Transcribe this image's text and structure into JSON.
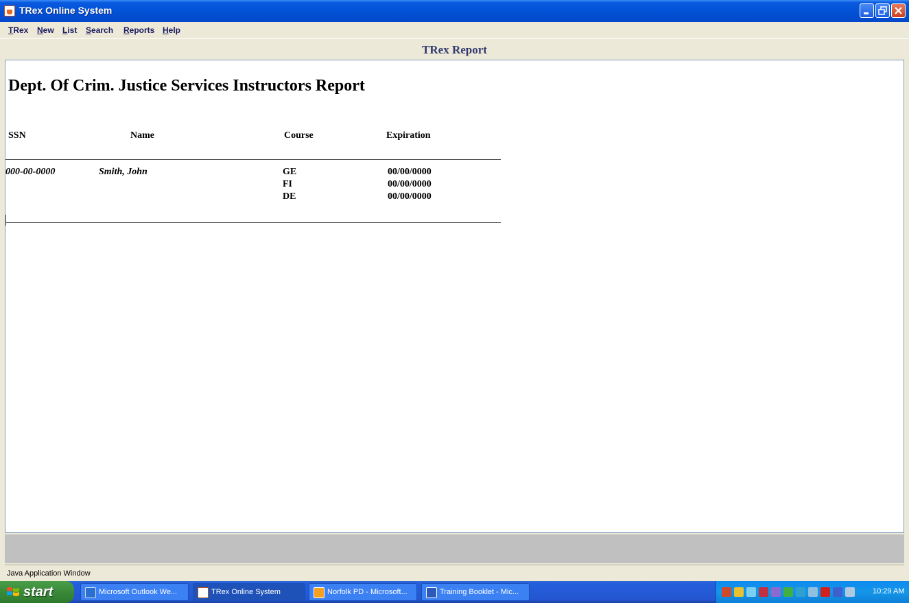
{
  "window": {
    "title": "TRex Online System"
  },
  "menu": {
    "items": [
      {
        "label": "TRex",
        "mnemonic": "T"
      },
      {
        "label": "New",
        "mnemonic": "N"
      },
      {
        "label": "List",
        "mnemonic": "L"
      },
      {
        "label": "Search",
        "mnemonic": "S"
      },
      {
        "label": "Reports",
        "mnemonic": "R"
      },
      {
        "label": "Help",
        "mnemonic": "H"
      }
    ]
  },
  "report": {
    "header": "TRex Report",
    "title": "Dept. Of Crim. Justice Services Instructors Report",
    "columns": {
      "ssn": "SSN",
      "name": "Name",
      "course": "Course",
      "expiration": "Expiration"
    },
    "rows": [
      {
        "ssn": "000-00-0000",
        "name": "Smith, John",
        "courses": [
          {
            "course": "GE",
            "expiration": "00/00/0000"
          },
          {
            "course": "FI",
            "expiration": "00/00/0000"
          },
          {
            "course": "DE",
            "expiration": "00/00/0000"
          }
        ]
      }
    ]
  },
  "status": {
    "text": "Java Application Window"
  },
  "taskbar": {
    "start_label": "start",
    "tasks": [
      {
        "label": "Microsoft Outlook We...",
        "icon": "outlook-icon",
        "active": false
      },
      {
        "label": "TRex Online System",
        "icon": "java-icon",
        "active": true
      },
      {
        "label": "Norfolk PD - Microsoft...",
        "icon": "browser-icon",
        "active": false
      },
      {
        "label": "Training Booklet - Mic...",
        "icon": "word-icon",
        "active": false
      }
    ],
    "clock": "10:29 AM"
  },
  "colors": {
    "titlebar": "#0252d6",
    "report_header_text": "#333a6e",
    "menu_text": "#1a1a60"
  }
}
